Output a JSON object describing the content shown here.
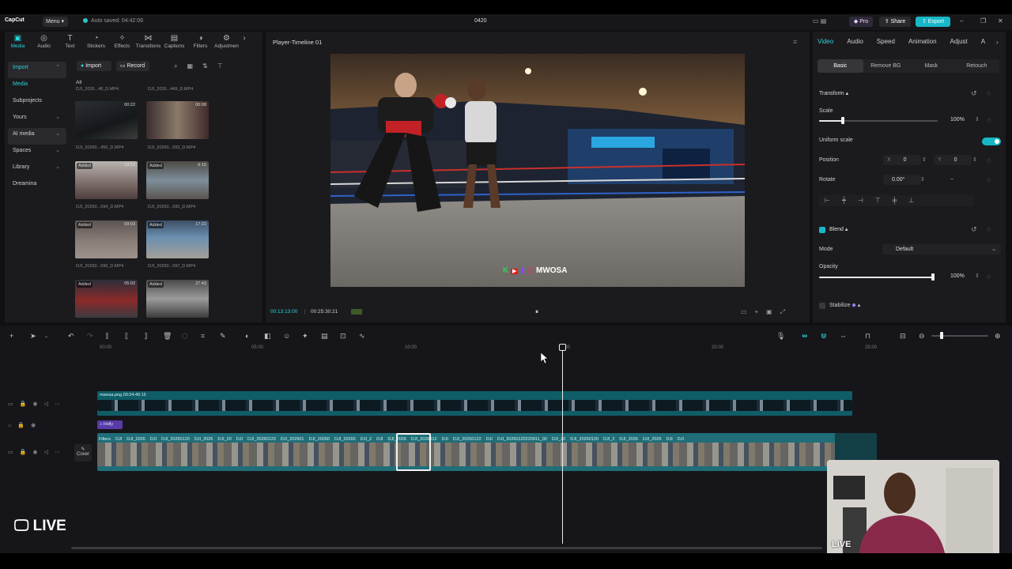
{
  "app": {
    "logo": "CapCut",
    "menu_label": "Menu",
    "autosave": "Auto saved: 04:42:06",
    "project_title": "0420",
    "pro_label": "Pro",
    "share_label": "Share",
    "export_label": "Export"
  },
  "toolbar": {
    "items": [
      {
        "label": "Media",
        "icon": "media-icon"
      },
      {
        "label": "Audio",
        "icon": "audio-icon"
      },
      {
        "label": "Text",
        "icon": "text-icon"
      },
      {
        "label": "Stickers",
        "icon": "stickers-icon"
      },
      {
        "label": "Effects",
        "icon": "effects-icon"
      },
      {
        "label": "Transitions",
        "icon": "transitions-icon"
      },
      {
        "label": "Captions",
        "icon": "captions-icon"
      },
      {
        "label": "Filters",
        "icon": "filters-icon"
      },
      {
        "label": "Adjustmen",
        "icon": "adjustment-icon"
      }
    ]
  },
  "sidebar": {
    "items": [
      {
        "label": "Import"
      },
      {
        "label": "Media"
      },
      {
        "label": "Subprojects"
      },
      {
        "label": "Yours"
      },
      {
        "label": "AI media"
      },
      {
        "label": "Spaces"
      },
      {
        "label": "Library"
      },
      {
        "label": "Dreamina"
      }
    ]
  },
  "media": {
    "import_label": "Import",
    "record_label": "Record",
    "all_label": "All",
    "top_files": [
      "DJI_2026...48_D.MP4",
      "DJI_2026...449_D.MP4"
    ],
    "items": [
      {
        "name": "DJI_20260...450_D.MP4",
        "badge": "",
        "duration": "00:22"
      },
      {
        "name": "DJI_20260...093_D.MP4",
        "badge": "",
        "duration": "00:08"
      },
      {
        "name": "DJI_20260...094_D.MP4",
        "badge": "Added",
        "duration": "19:52"
      },
      {
        "name": "DJI_20260...095_D.MP4",
        "badge": "Added",
        "duration": "6:15"
      },
      {
        "name": "DJI_20260...096_D.MP4",
        "badge": "Added",
        "duration": "09:03"
      },
      {
        "name": "DJI_20260...097_D.MP4",
        "badge": "Added",
        "duration": "17:22"
      },
      {
        "name": "",
        "badge": "Added",
        "duration": "05:02"
      },
      {
        "name": "",
        "badge": "Added",
        "duration": "27:43"
      }
    ]
  },
  "player": {
    "title": "Player-Timeline 01",
    "brand_text": "MWOSA",
    "current_time": "00:13:13:00",
    "total_time": "00:25:30:21"
  },
  "properties": {
    "tabs": [
      "Video",
      "Audio",
      "Speed",
      "Animation",
      "Adjust",
      "A"
    ],
    "subtabs": [
      "Basic",
      "Remove BG",
      "Mask",
      "Retouch"
    ],
    "transform_label": "Transform",
    "scale_label": "Scale",
    "scale_value": "100%",
    "uniform_scale_label": "Uniform scale",
    "position_label": "Position",
    "pos_x_label": "X",
    "pos_x": "0",
    "pos_y_label": "Y",
    "pos_y": "0",
    "rotate_label": "Rotate",
    "rotate_value": "0.00°",
    "rotate_dash": "–",
    "blend_label": "Blend",
    "mode_label": "Mode",
    "mode_value": "Default",
    "opacity_label": "Opacity",
    "opacity_value": "100%",
    "stabilize_label": "Stabilize",
    "scale_level": 0.2,
    "opacity_level": 1.0
  },
  "timeline": {
    "ruler": [
      "00:00",
      "05:00",
      "10:00",
      "15:00",
      "20:00",
      "25:00"
    ],
    "overlay_clip_label": "mwosa.png  00:24:40:15",
    "text_clip_label": "Holly",
    "main_clip_labels": [
      "Filters",
      "DJI",
      "DJI_2026",
      "DJI",
      "DJI_20260120",
      "DJI_2026",
      "DJI_20",
      "DJI",
      "DJI_20260120",
      "DJI_202601",
      "DJI_20260",
      "DJI_20260",
      "DJI_2",
      "DJI",
      "DJI_2026",
      "DJI_2026012",
      "DJI",
      "DJI_20260122",
      "DJI",
      "DJI_20260120220911_00",
      "DJI_20",
      "DJI_20260120",
      "DJI_2",
      "DJI_2026",
      "DJI_2026",
      "DJI",
      "DJI"
    ],
    "cover_label": "Cover"
  },
  "overlay": {
    "live_left": "LIVE",
    "live_cam": "LIVE"
  },
  "colors": {
    "accent": "#2ad3d8",
    "export": "#17b8c8",
    "track_main": "#1f6e78",
    "track_overlay": "#0f5d66"
  }
}
